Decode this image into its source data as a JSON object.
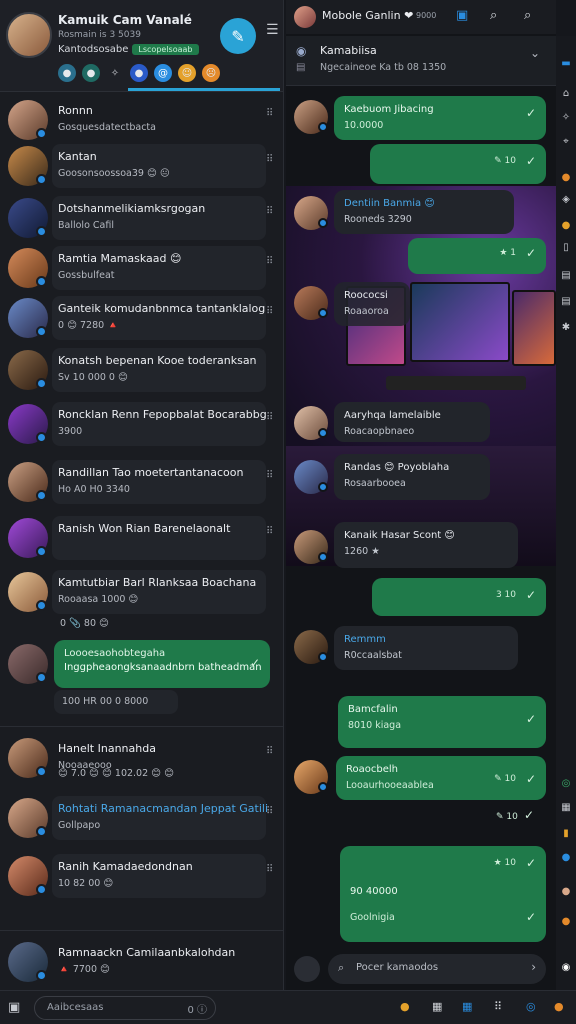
{
  "profile": {
    "name": "Kamuik Cam Vanalé",
    "status": "Rosmain is 3 5039",
    "sub": "Kantodsosabe",
    "pill": "Lscopelsoaab",
    "menu_icon": "hamburger-icon",
    "compose_icon": "pencil-icon"
  },
  "chats": [
    {
      "title": "Ronnn",
      "preview": "Gosquesdatectbacta"
    },
    {
      "title": "Kantan",
      "preview": "Goosonsoossoa39 😊 😐"
    },
    {
      "title": "Dotshanmelikiamksrgogan",
      "preview": "Ballolo Cafil"
    },
    {
      "title": "Ramtia Mamaskaad 😊",
      "preview": "Gossbulfeat"
    },
    {
      "title": "Ganteik komudanbnmca tantanklalog",
      "preview": "0 😊 7280 🔺"
    },
    {
      "title": "Konatsh bepenan Kooe toderanksan",
      "preview": "Sv 10 000 0 😊"
    },
    {
      "title": "Roncklan Renn Fepopbalat Bocarabbg",
      "preview": "3900"
    },
    {
      "title": "Randillan Tao moetertantanacoon",
      "preview": "Ho A0 H0 3340"
    },
    {
      "title": "Ranish Won Rian Barenelaonalt",
      "preview": ""
    },
    {
      "title": "Kamtutbiar Barl Rlanksaa Boachana",
      "preview": "Rooaasa 1000 😊"
    }
  ],
  "chat_10_meta": "0 📎 80 😊",
  "green_card": {
    "line1": "Loooesaohobtegaha",
    "line2": "Inggpheaongksanaadnbrn batheadman"
  },
  "green_card_footer": "100 HR 00 0 8000",
  "chats_lower": [
    {
      "title": "Hanelt Inannahda",
      "preview": "Nooaaeooo"
    },
    {
      "title": "Rohtati Ramanacmandan Jeppat Gatili",
      "preview": "Gollpapo"
    },
    {
      "title": "Ranih Kamadaedondnan",
      "preview": "10 82 00 😊"
    },
    {
      "title": "Ramnaackn Camilaanbkalohdan",
      "preview": "🔺 7700 😊"
    }
  ],
  "topbar": {
    "title": "Mobole Ganlin ❤",
    "badge": "9000"
  },
  "chat_header": {
    "title": "Kamabiisa",
    "subtitle": "Ngecaineoe Ka tb 08 1350"
  },
  "messages": [
    {
      "l1": "Kaebuom Jibacing",
      "l2": "10.0000"
    },
    {
      "l1": "Dentiin Banmia 😊",
      "l2": "Rooneds 3290"
    },
    {
      "l1": "Roococsi",
      "l2": "Roaaoroa"
    },
    {
      "l1": "Aaryhqa lamelaible",
      "l2": "Roacaopbnaeo"
    },
    {
      "l1": "Randas 😊 Poyoblaha",
      "l2": "Rosaarbooea"
    },
    {
      "l1": "Kanaik Hasar Scont 😊",
      "l2": "1260 ★"
    },
    {
      "l1": "Remmm",
      "l2": "R0ccaalsbat"
    },
    {
      "l1": "Bamcfalin",
      "l2": "8010 kiaga"
    },
    {
      "l1": "Roaocbelh",
      "l2": "Looaurhooeaablea"
    },
    {
      "l1": "90 40000",
      "l2": "Goolnigia"
    }
  ],
  "out_times": [
    "✎ 10",
    "★ 1",
    "3 10",
    "✎ 10",
    "✎ 10",
    "★ 10"
  ],
  "input": {
    "placeholder": "Pocer kamaodos"
  },
  "bottombar": {
    "search_placeholder": "Aaibcesaas",
    "search_right": "0 ⓘ"
  },
  "colors": {
    "accent": "#2aa3d6",
    "outgoing_bubble": "#1f7a4a",
    "incoming_bubble": "#22252b"
  }
}
